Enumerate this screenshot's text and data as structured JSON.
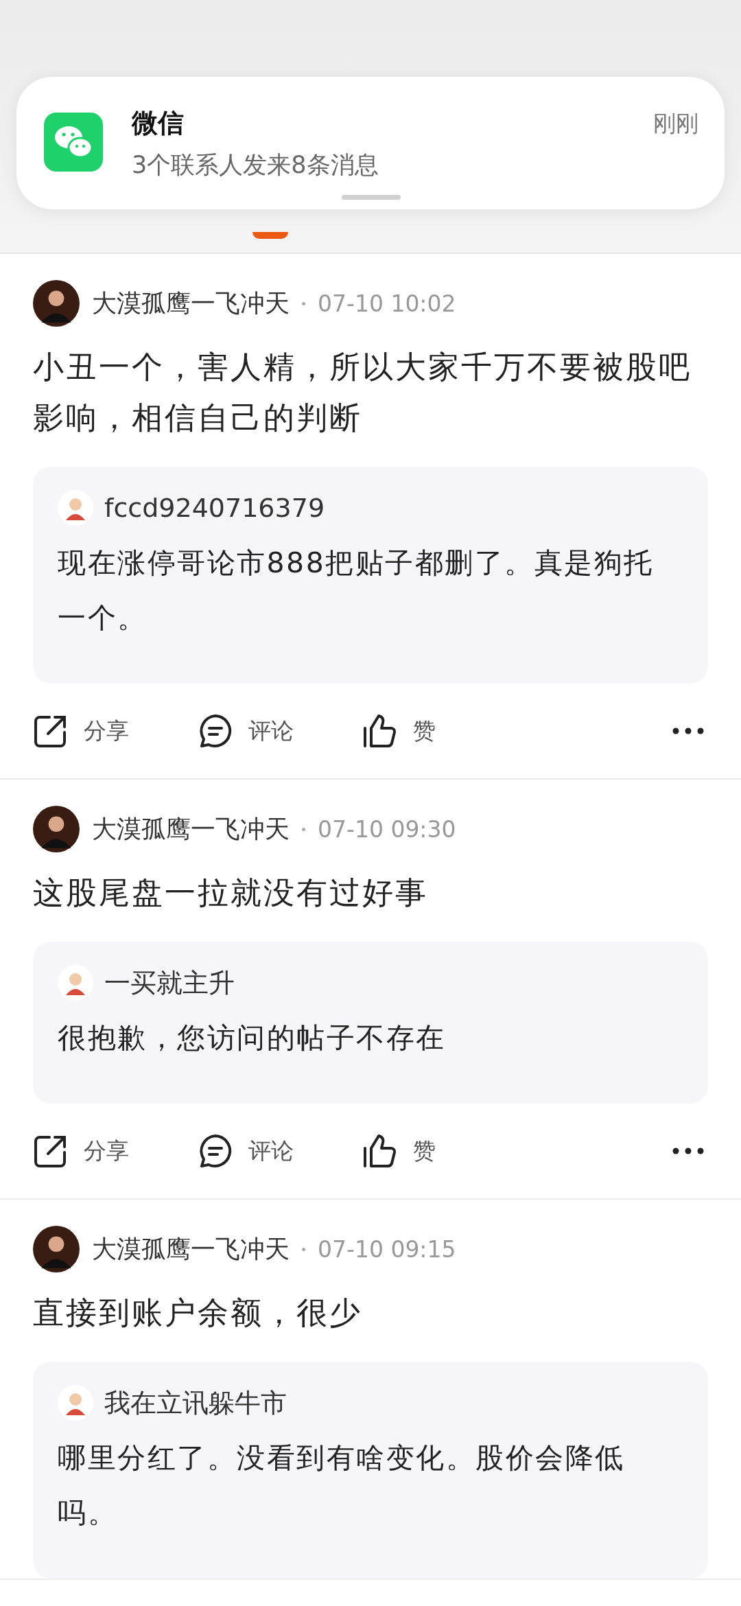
{
  "notification": {
    "app": "微信",
    "message": "3个联系人发来8条消息",
    "time": "刚刚"
  },
  "posts": [
    {
      "author": "大漠孤鹰一飞冲天",
      "time": "07-10 10:02",
      "content": "小丑一个，害人精，所以大家千万不要被股吧影响，相信自己的判断",
      "quote": {
        "author": "fccd9240716379",
        "content": "现在涨停哥论市888把贴子都删了。真是狗托一个。"
      },
      "actions": [
        {
          "kind": "share",
          "label": "分享"
        },
        {
          "kind": "comment",
          "label": "评论"
        },
        {
          "kind": "like",
          "label": "赞"
        }
      ]
    },
    {
      "author": "大漠孤鹰一飞冲天",
      "time": "07-10 09:30",
      "content": "这股尾盘一拉就没有过好事",
      "quote": {
        "author": "一买就主升",
        "content": "很抱歉，您访问的帖子不存在"
      },
      "actions": [
        {
          "kind": "share",
          "label": "分享"
        },
        {
          "kind": "comment",
          "label": "评论"
        },
        {
          "kind": "like",
          "label": "赞"
        }
      ]
    },
    {
      "author": "大漠孤鹰一飞冲天",
      "time": "07-10 09:15",
      "content": "直接到账户余额，很少",
      "quote": {
        "author": "我在立讯躲牛市",
        "content": "哪里分红了。没看到有啥变化。股价会降低吗。"
      }
    }
  ]
}
